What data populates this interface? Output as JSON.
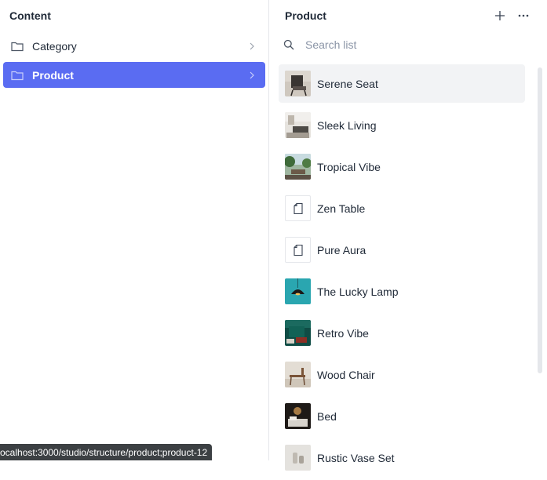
{
  "content_pane": {
    "title": "Content",
    "items": [
      {
        "label": "Category",
        "icon": "folder-icon",
        "active": false
      },
      {
        "label": "Product",
        "icon": "folder-icon",
        "active": true
      }
    ]
  },
  "product_pane": {
    "title": "Product",
    "add_icon": "plus-icon",
    "more_icon": "ellipsis-icon",
    "search": {
      "placeholder": "Search list",
      "value": ""
    },
    "items": [
      {
        "title": "Serene Seat",
        "thumb": "image"
      },
      {
        "title": "Sleek Living",
        "thumb": "image"
      },
      {
        "title": "Tropical Vibe",
        "thumb": "image"
      },
      {
        "title": "Zen Table",
        "thumb": "document-icon"
      },
      {
        "title": "Pure Aura",
        "thumb": "document-icon"
      },
      {
        "title": "The Lucky Lamp",
        "thumb": "image"
      },
      {
        "title": "Retro Vibe",
        "thumb": "image"
      },
      {
        "title": "Wood Chair",
        "thumb": "image"
      },
      {
        "title": "Bed",
        "thumb": "image"
      },
      {
        "title": "Rustic Vase Set",
        "thumb": "image"
      }
    ]
  },
  "status_url": "ocalhost:3000/studio/structure/product;product-12",
  "colors": {
    "accent": "#5a6cf2",
    "selected_bg": "#f2f3f5",
    "tooltip_bg": "#3c4043"
  }
}
